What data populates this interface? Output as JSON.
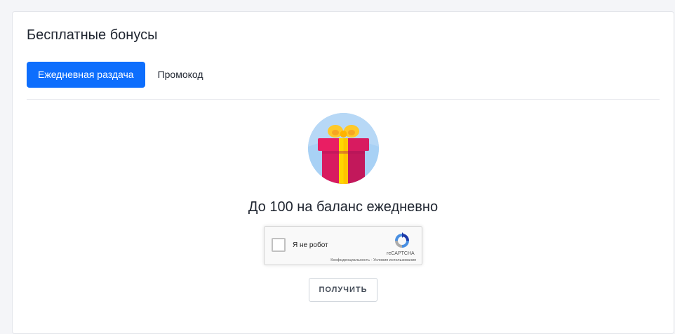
{
  "card": {
    "title": "Бесплатные бонусы"
  },
  "tabs": [
    {
      "label": "Ежедневная раздача",
      "active": true
    },
    {
      "label": "Промокод",
      "active": false
    }
  ],
  "reward": {
    "icon": "gift-icon",
    "headline": "До 100 на баланс ежедневно"
  },
  "recaptcha": {
    "label": "Я не робот",
    "brand": "reCAPTCHA",
    "privacy_link": "Конфиденциальность",
    "separator": "-",
    "terms_link": "Условия использования",
    "checked": false
  },
  "actions": {
    "get_label": "ПОЛУЧИТЬ"
  },
  "colors": {
    "accent": "#0d6efd",
    "page_bg": "#f4f5f8",
    "gift_circle": "#a8d1f5",
    "gift_box": "#d81b60",
    "gift_ribbon": "#ffd600"
  }
}
